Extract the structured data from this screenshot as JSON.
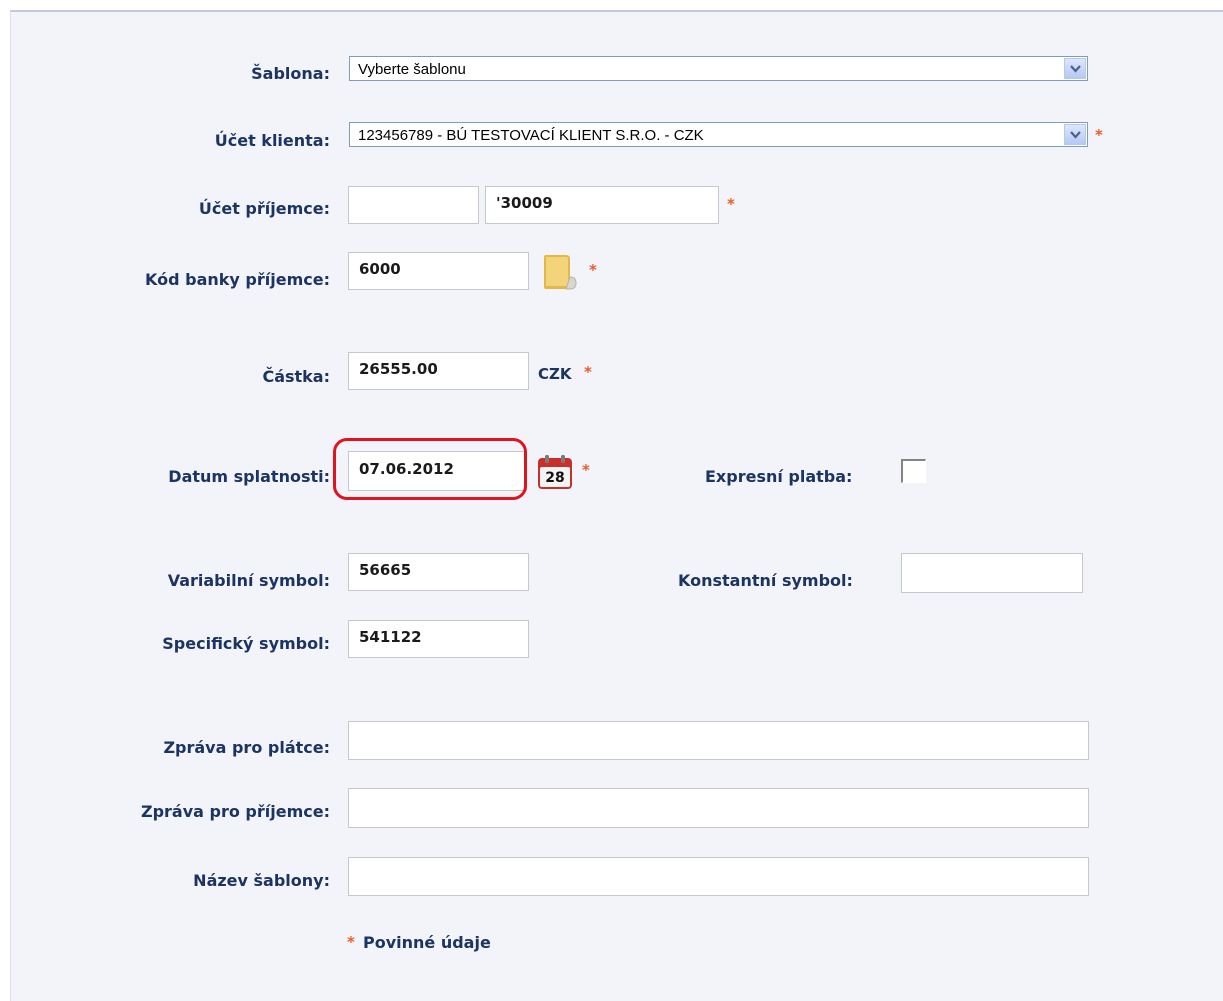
{
  "form": {
    "sablona": {
      "label": "Šablona:",
      "value": "Vyberte šablonu"
    },
    "ucet_klienta": {
      "label": "Účet klienta:",
      "value": "123456789 - BÚ TESTOVACÍ KLIENT S.R.O. - CZK"
    },
    "ucet_prijemce": {
      "label": "Účet příjemce:",
      "prefix": "",
      "number": "'30009"
    },
    "kod_banky": {
      "label": "Kód banky příjemce:",
      "value": "6000"
    },
    "castka": {
      "label": "Částka:",
      "value": "26555.00",
      "currency": "CZK"
    },
    "datum": {
      "label": "Datum splatnosti:",
      "value": "07.06.2012",
      "calendar_day": "28"
    },
    "expresni": {
      "label": "Expresní platba:",
      "checked": false
    },
    "variabilni": {
      "label": "Variabilní symbol:",
      "value": "56665"
    },
    "konstantni": {
      "label": "Konstantní symbol:",
      "value": ""
    },
    "specificky": {
      "label": "Specifický symbol:",
      "value": "541122"
    },
    "zprava_platce": {
      "label": "Zpráva pro plátce:",
      "value": ""
    },
    "zprava_prijemce": {
      "label": "Zpráva pro příjemce:",
      "value": ""
    },
    "nazev_sablony": {
      "label": "Název šablony:",
      "value": ""
    },
    "required_star": "*",
    "required_note": "Povinné údaje"
  },
  "colors": {
    "label": "#1c3462",
    "required": "#f05a28",
    "highlight": "#e0141e",
    "panel_bg": "#f3f4f9"
  },
  "icons": {
    "bank_code_lookup": "folder-icon",
    "date_picker": "calendar-icon",
    "dropdown": "chevron-down-icon"
  }
}
